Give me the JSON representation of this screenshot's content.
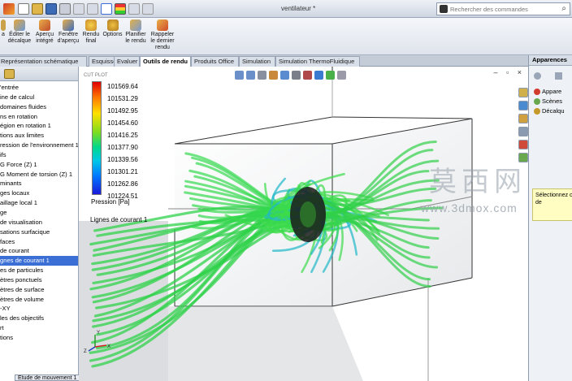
{
  "window": {
    "document_title": "ventilateur *",
    "command_search_placeholder": "Rechercher des commandes"
  },
  "ribbon": {
    "buttons": [
      {
        "label": "Éditer le\ndécalque",
        "icon": "edit-decal-icon"
      },
      {
        "label": "Aperçu\nintégré",
        "icon": "integrated-preview-icon"
      },
      {
        "label": "Fenêtre\nd'aperçu",
        "icon": "preview-window-icon"
      },
      {
        "label": "Rendu\nfinal",
        "icon": "final-render-icon"
      },
      {
        "label": "Options",
        "icon": "options-icon"
      },
      {
        "label": "Planifier\nle rendu",
        "icon": "schedule-render-icon"
      },
      {
        "label": "Rappeler\nle dernier\nrendu",
        "icon": "recall-render-icon"
      }
    ],
    "first_button_partial": "a"
  },
  "tabs": [
    {
      "label": "Représentation schématique",
      "active": false
    },
    {
      "label": "Esquisse",
      "active": false
    },
    {
      "label": "Evaluer",
      "active": false
    },
    {
      "label": "Outils de rendu",
      "active": true
    },
    {
      "label": "Produits Office",
      "active": false
    },
    {
      "label": "Simulation",
      "active": false
    },
    {
      "label": "Simulation ThermoFluidique",
      "active": false
    }
  ],
  "tree": {
    "items": [
      "'entrée",
      "ine de calcul",
      "domaines fluides",
      "ns en rotation",
      "égion en rotation 1",
      "tions aux limites",
      "ression de l'environnement 1",
      "ifs",
      "G Force (Z) 1",
      "G Moment de torsion (Z) 1",
      "minants",
      "ges locaux",
      "aillage local 1",
      "ge",
      "de visualisation",
      "sations surfacique",
      "faces",
      "de courant",
      "gnes de courant 1",
      "es de particules",
      "ètres ponctuels",
      "ètres de surface",
      "ètres de volume",
      "-XY",
      "les des objectifs",
      "rt",
      "tions"
    ],
    "selected_index": 18,
    "bottom_tab": "Etude de mouvement 1"
  },
  "legend": {
    "values": [
      "101569.64",
      "101531.29",
      "101492.95",
      "101454.60",
      "101416.25",
      "101377.90",
      "101339.56",
      "101301.21",
      "101262.86",
      "101224.51"
    ],
    "title": "Pression [Pa]",
    "caption": "CUT PLOT"
  },
  "viewport": {
    "streamline_label": "Lignes de courant 1"
  },
  "right_panel": {
    "title": "Apparences",
    "items": [
      {
        "label": "Appare",
        "color": "#d23c2c"
      },
      {
        "label": "Scènes",
        "color": "#6aa84f"
      },
      {
        "label": "Décalqu",
        "color": "#c59a2b"
      }
    ],
    "note": "Sélectionnez c\nde"
  },
  "watermark": {
    "chinese": "莫西网",
    "url": "www.3dmox.com"
  }
}
